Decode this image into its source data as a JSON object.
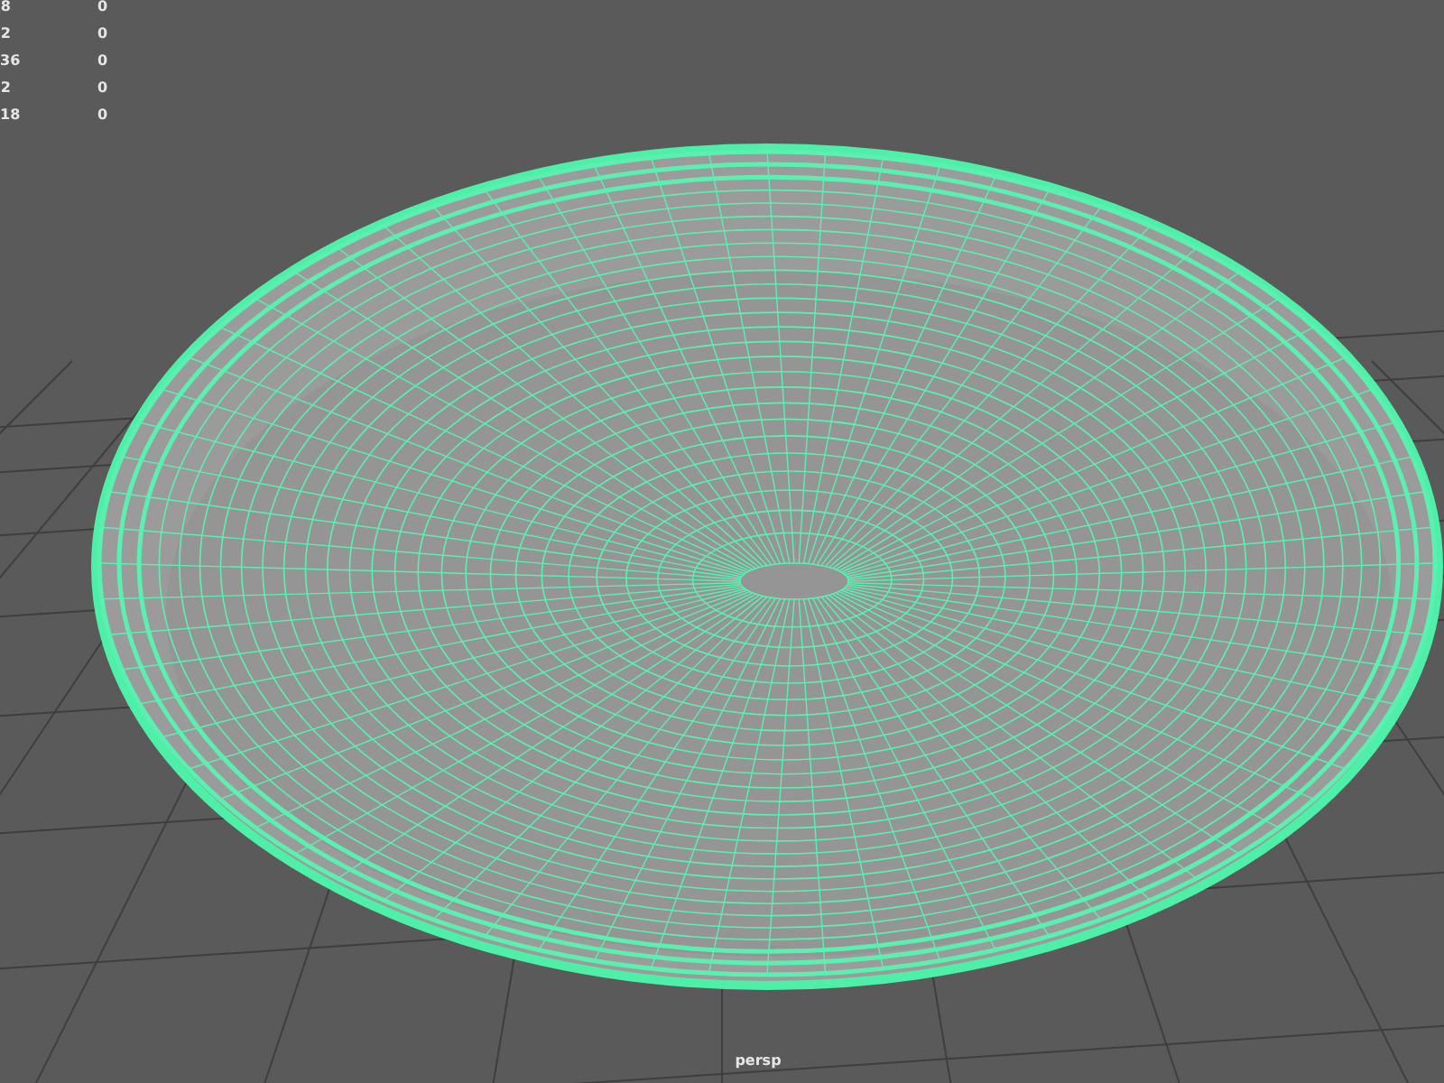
{
  "hud": {
    "rows": [
      {
        "label": "8",
        "value": "0"
      },
      {
        "label": "2",
        "value": "0"
      },
      {
        "label": "36",
        "value": "0"
      },
      {
        "label": "2",
        "value": "0"
      },
      {
        "label": "18",
        "value": "0"
      }
    ]
  },
  "camera_label": "persp"
}
